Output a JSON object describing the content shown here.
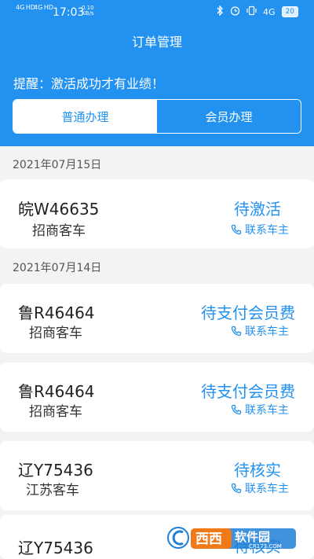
{
  "statusbar": {
    "sig1": "4G HD",
    "sig2": "4G HD",
    "time": "17:03",
    "speed_value": "0.10",
    "speed_unit": "KB/s",
    "net": "4G",
    "battery": "20"
  },
  "header": {
    "title": "订单管理",
    "notice": "提醒：激活成功才有业绩！",
    "tabs": [
      {
        "label": "普通办理"
      },
      {
        "label": "会员办理"
      }
    ]
  },
  "groups": [
    {
      "date": "2021年07月15日"
    },
    {
      "date": "2021年07月14日"
    }
  ],
  "orders": [
    {
      "plate": "皖W46635",
      "type": "招商客车",
      "status": "待激活",
      "contact": "联系车主"
    },
    {
      "plate": "鲁R46464",
      "type": "招商客车",
      "status": "待支付会员费",
      "contact": "联系车主"
    },
    {
      "plate": "鲁R46464",
      "type": "招商客车",
      "status": "待支付会员费",
      "contact": "联系车主"
    },
    {
      "plate": "辽Y75436",
      "type": "江苏客车",
      "status": "待核实",
      "contact": "联系车主"
    },
    {
      "plate": "辽Y75436",
      "status": "待核实"
    }
  ],
  "colors": {
    "primary": "#2291f0",
    "background": "#f2f3f5"
  },
  "watermark": {
    "text": "西西软件园",
    "sub": "CR173.COM"
  }
}
